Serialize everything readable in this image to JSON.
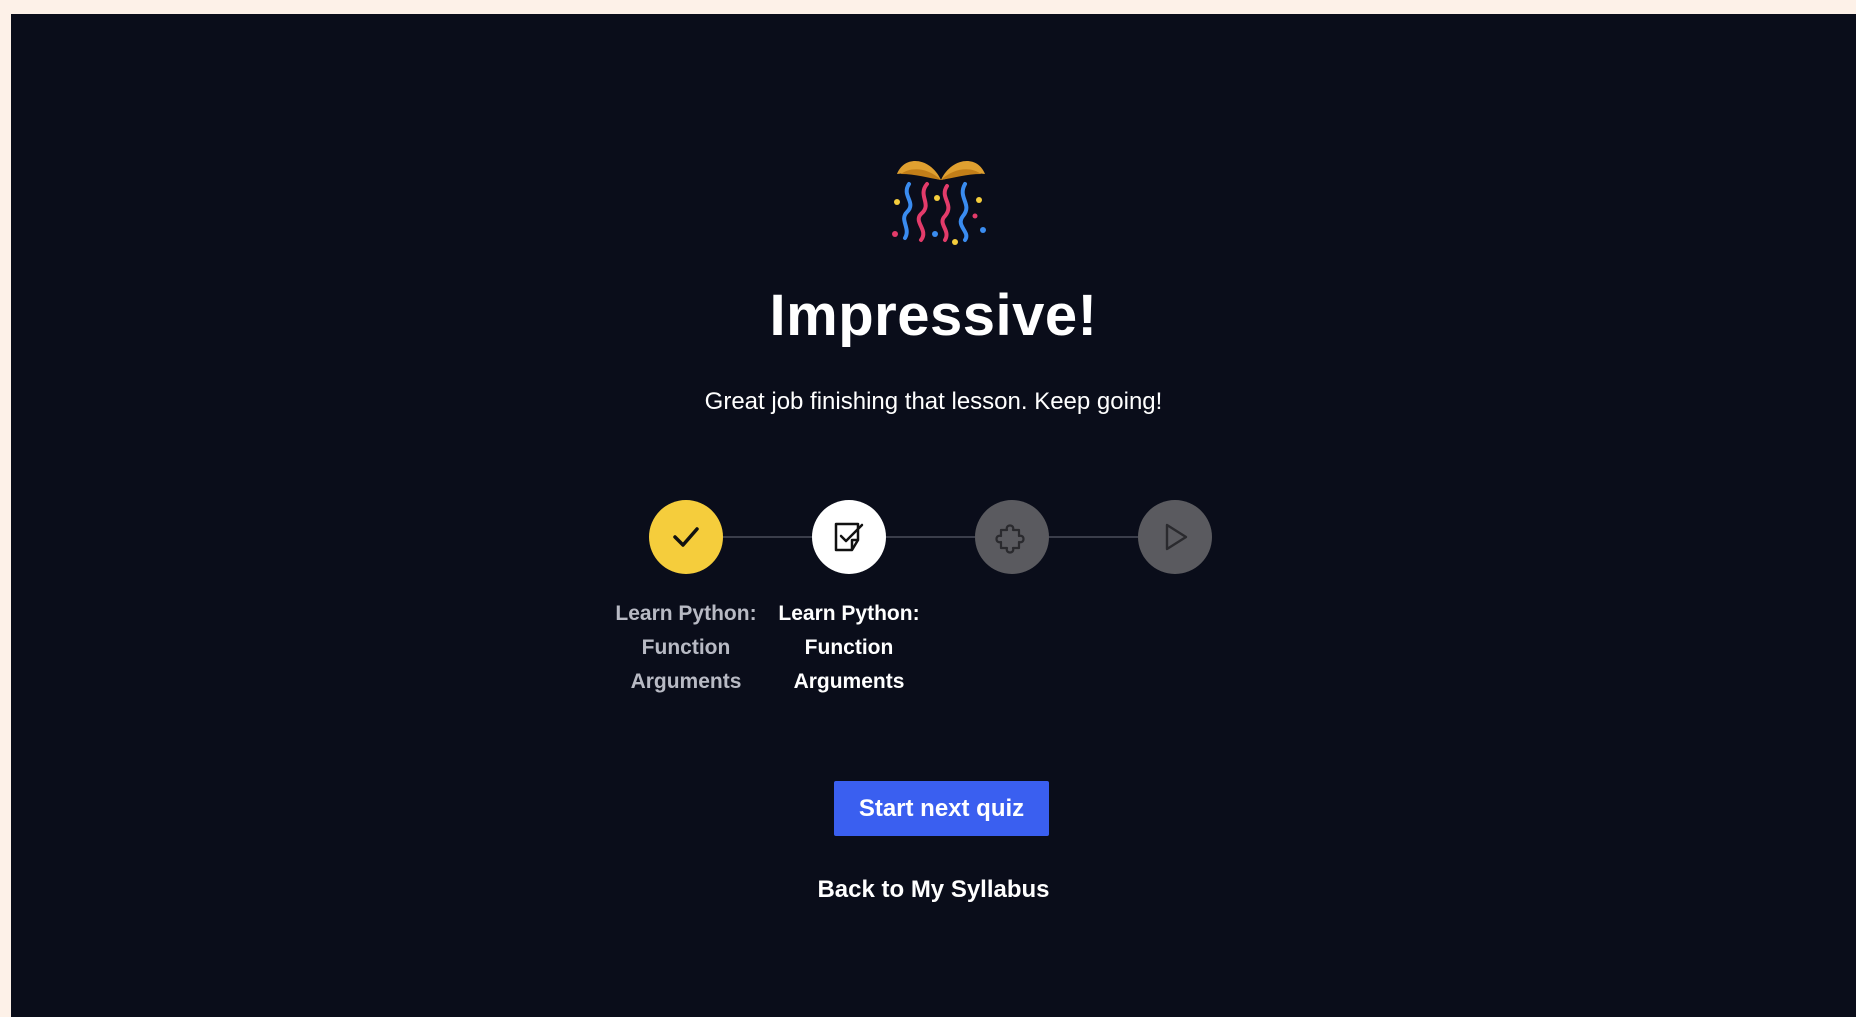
{
  "completion": {
    "icon": "party-popper-icon",
    "headline": "Impressive!",
    "subtitle": "Great job finishing that lesson. Keep going!"
  },
  "progress": {
    "steps": [
      {
        "icon": "checkmark-icon",
        "status": "completed",
        "label_lines": [
          "Learn Python:",
          "Function",
          "Arguments"
        ]
      },
      {
        "icon": "quiz-icon",
        "status": "current",
        "label_lines": [
          "Learn Python:",
          "Function",
          "Arguments"
        ]
      },
      {
        "icon": "puzzle-icon",
        "status": "locked",
        "label_lines": []
      },
      {
        "icon": "play-icon",
        "status": "locked",
        "label_lines": []
      }
    ]
  },
  "actions": {
    "primary_label": "Start next quiz",
    "secondary_label": "Back to My Syllabus"
  },
  "colors": {
    "background": "#0a0d1a",
    "completed": "#f5cd3c",
    "current": "#ffffff",
    "locked": "#5a5a5f",
    "primary_button": "#3a5ff0"
  }
}
